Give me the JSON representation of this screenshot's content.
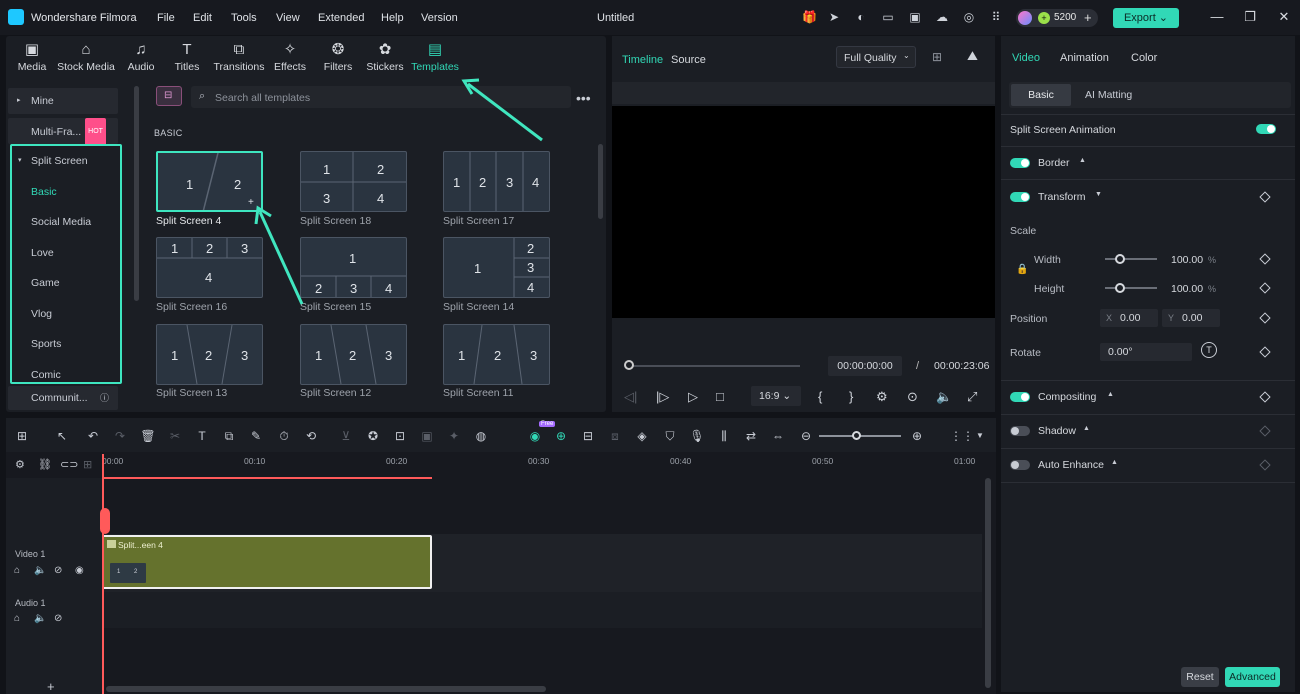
{
  "app": {
    "name": "Wondershare Filmora",
    "document_title": "Untitled",
    "credits": "5200",
    "export_label": "Export"
  },
  "menu": [
    "File",
    "Edit",
    "Tools",
    "View",
    "Extended",
    "Help",
    "Version"
  ],
  "media_tabs": [
    {
      "label": "Media",
      "icon": "media-icon"
    },
    {
      "label": "Stock Media",
      "icon": "stock-media-icon"
    },
    {
      "label": "Audio",
      "icon": "audio-icon"
    },
    {
      "label": "Titles",
      "icon": "titles-icon"
    },
    {
      "label": "Transitions",
      "icon": "transitions-icon"
    },
    {
      "label": "Effects",
      "icon": "effects-icon"
    },
    {
      "label": "Filters",
      "icon": "filters-icon"
    },
    {
      "label": "Stickers",
      "icon": "stickers-icon"
    },
    {
      "label": "Templates",
      "icon": "templates-icon",
      "active": true
    }
  ],
  "sidebar": {
    "mine": "Mine",
    "multi_frame": "Multi-Fra...",
    "hot_badge": "HOT",
    "split_screen": "Split Screen",
    "sub_items": [
      "Basic",
      "Social Media",
      "Love",
      "Game",
      "Vlog",
      "Sports",
      "Comic"
    ],
    "community": "Communit..."
  },
  "search": {
    "placeholder": "Search all templates"
  },
  "section_label": "BASIC",
  "templates": [
    {
      "name": "Split Screen 4",
      "selected": true
    },
    {
      "name": "Split Screen 18"
    },
    {
      "name": "Split Screen 17"
    },
    {
      "name": "Split Screen 16"
    },
    {
      "name": "Split Screen 15"
    },
    {
      "name": "Split Screen 14"
    },
    {
      "name": "Split Screen 13"
    },
    {
      "name": "Split Screen 12"
    },
    {
      "name": "Split Screen 11"
    }
  ],
  "tile_numbers": [
    "1",
    "2",
    "3",
    "4"
  ],
  "preview": {
    "tab_timeline": "Timeline",
    "tab_source": "Source",
    "quality": "Full Quality",
    "current_time": "00:00:00:00",
    "separator": "/",
    "total_time": "00:00:23:06",
    "aspect_ratio": "16:9"
  },
  "right_panel": {
    "tabs": [
      "Video",
      "Animation",
      "Color"
    ],
    "subtabs": [
      "Basic",
      "AI Matting"
    ],
    "split_screen_animation": "Split Screen Animation",
    "border": "Border",
    "transform": "Transform",
    "scale": "Scale",
    "width": "Width",
    "width_value": "100.00",
    "height": "Height",
    "height_value": "100.00",
    "unit": "%",
    "position": "Position",
    "pos_x_label": "X",
    "pos_x": "0.00",
    "pos_y_label": "Y",
    "pos_y": "0.00",
    "rotate": "Rotate",
    "rotate_value": "0.00°",
    "compositing": "Compositing",
    "shadow": "Shadow",
    "auto_enhance": "Auto Enhance",
    "reset": "Reset",
    "advanced": "Advanced"
  },
  "timeline": {
    "ruler": [
      "00:00",
      "00:10",
      "00:20",
      "00:30",
      "00:40",
      "00:50",
      "01:00"
    ],
    "video_track": "Video 1",
    "audio_track": "Audio 1",
    "clip_name": "Split...een 4",
    "new_badge": "Free"
  },
  "colors": {
    "accent": "#31d8b6",
    "playhead": "#ff5a5a",
    "clip": "#65722d",
    "highlight": "#3ee6c0"
  }
}
